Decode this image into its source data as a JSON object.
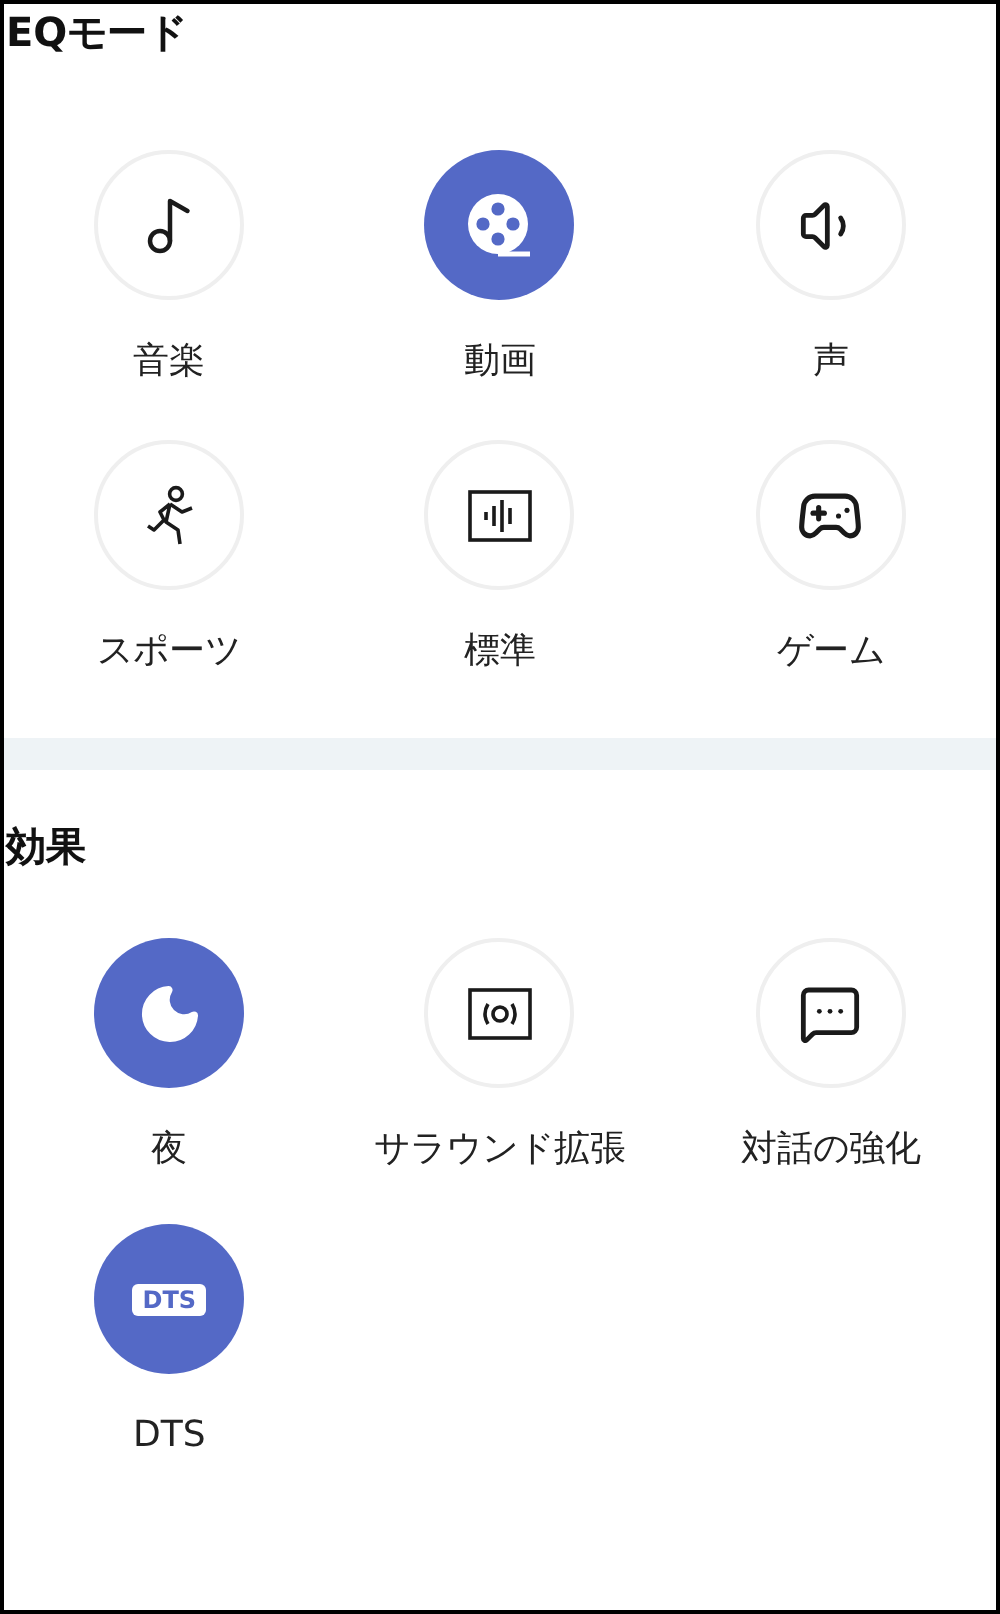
{
  "sections": [
    {
      "title": "EQモード",
      "items": [
        {
          "kind": "music",
          "label": "音楽",
          "selected": false
        },
        {
          "kind": "video",
          "label": "動画",
          "selected": true
        },
        {
          "kind": "voice",
          "label": "声",
          "selected": false
        },
        {
          "kind": "sports",
          "label": "スポーツ",
          "selected": false
        },
        {
          "kind": "standard",
          "label": "標準",
          "selected": false
        },
        {
          "kind": "game",
          "label": "ゲーム",
          "selected": false
        }
      ]
    },
    {
      "title": "効果",
      "items": [
        {
          "kind": "night",
          "label": "夜",
          "selected": true
        },
        {
          "kind": "surround",
          "label": "サラウンド拡張",
          "selected": false
        },
        {
          "kind": "dialogue",
          "label": "対話の強化",
          "selected": false
        },
        {
          "kind": "dts",
          "label": "DTS",
          "badge": "DTS",
          "selected": true
        }
      ]
    }
  ]
}
